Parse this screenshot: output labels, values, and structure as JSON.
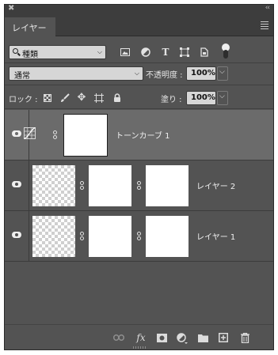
{
  "panel": {
    "tab_label": "レイヤー",
    "close_glyph": "✖",
    "collapse_glyph": "‹‹"
  },
  "filter": {
    "kind_label": "種類",
    "icons": [
      "image-filter-icon",
      "adjustment-filter-icon",
      "type-filter-icon",
      "shape-filter-icon",
      "smart-object-filter-icon",
      "filter-toggle"
    ]
  },
  "blend": {
    "mode": "通常",
    "opacity_label": "不透明度 :",
    "opacity_value": "100%"
  },
  "lock": {
    "label": "ロック :",
    "icons": [
      "lock-transparent-icon",
      "lock-paint-icon",
      "lock-position-icon",
      "lock-artboard-icon",
      "lock-all-icon"
    ],
    "fill_label": "塗り :",
    "fill_value": "100%"
  },
  "layers": [
    {
      "name": "トーンカーブ 1",
      "type": "adjustment",
      "selected": true,
      "visible": true
    },
    {
      "name": "レイヤー 2",
      "type": "pixel",
      "selected": false,
      "visible": true
    },
    {
      "name": "レイヤー 1",
      "type": "pixel",
      "selected": false,
      "visible": true
    }
  ],
  "bottom_icons": [
    "link-layers-icon",
    "fx-icon",
    "add-mask-icon",
    "new-adjustment-icon",
    "new-group-icon",
    "new-layer-icon",
    "delete-icon"
  ],
  "bottom": {
    "fx_label": "fx"
  },
  "colors": {
    "panel_bg": "#535353",
    "selected_row": "#6b6b6b",
    "field_bg": "#d6d6d6"
  }
}
